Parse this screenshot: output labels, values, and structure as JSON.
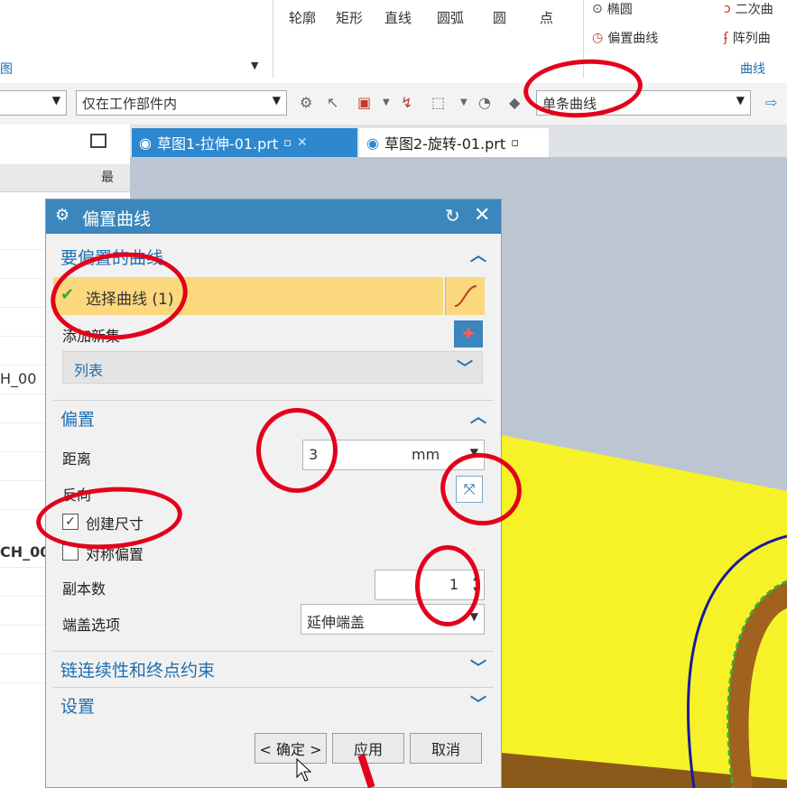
{
  "ribbon": {
    "buttons": [
      "轮廓",
      "矩形",
      "直线",
      "圆弧",
      "圆",
      "点"
    ],
    "right_items": {
      "ellipse": "椭圆",
      "offset_curve": "偏置曲线",
      "conic": "二次曲",
      "pattern_curve": "阵列曲"
    },
    "group_label_left": "图",
    "group_label_right": "曲线"
  },
  "toolbar": {
    "filter_scope": "仅在工作部件内",
    "curve_rule": "单条曲线"
  },
  "navigator": {
    "row_text_1": "H_00",
    "row_text_2": "CH_00",
    "side_label": "最"
  },
  "tabs": [
    {
      "label": "草图1-拉伸-01.prt",
      "active": true
    },
    {
      "label": "草图2-旋转-01.prt",
      "active": false
    }
  ],
  "dialog": {
    "title": "偏置曲线",
    "section_curve": {
      "title": "要偏置的曲线",
      "select_label": "选择曲线 (1)",
      "add_set": "添加新集",
      "list": "列表"
    },
    "section_offset": {
      "title": "偏置",
      "distance_label": "距离",
      "distance_value": "3",
      "distance_unit": "mm",
      "reverse_label": "反向",
      "create_dimension": "创建尺寸",
      "symmetric": "对称偏置",
      "copies_label": "副本数",
      "copies_value": "1",
      "cap_label": "端盖选项",
      "cap_value": "延伸端盖"
    },
    "section_chain": {
      "title": "链连续性和终点约束"
    },
    "section_settings": {
      "title": "设置"
    },
    "buttons": {
      "ok": "< 确定 >",
      "apply": "应用",
      "cancel": "取消"
    }
  },
  "colors": {
    "title_bar": "#3b86bd",
    "selection_highlight": "#fbd77d",
    "model_yellow": "#f7f227",
    "annotation_red": "#e3001b"
  }
}
